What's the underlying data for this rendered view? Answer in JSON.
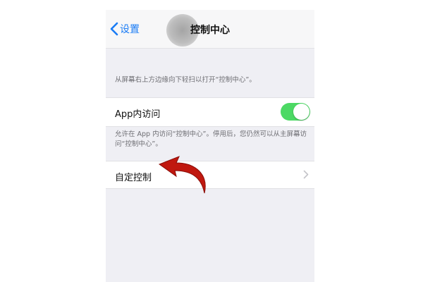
{
  "nav": {
    "back_label": "设置",
    "title": "控制中心"
  },
  "hint_swipe": "从屏幕右上方边缘向下轻扫以打开“控制中心”。",
  "access_within_apps": {
    "label": "App内访问",
    "toggle_on": true,
    "toggle_color": "#4cd964"
  },
  "hint_access": "允许在 App 内访问“控制中心”。停用后，您仍然可以从主屏幕访问“控制中心”。",
  "customize": {
    "label": "自定控制"
  },
  "colors": {
    "accent": "#1a7cf5",
    "background": "#efeff4",
    "annotation_arrow": "#c0180f"
  }
}
